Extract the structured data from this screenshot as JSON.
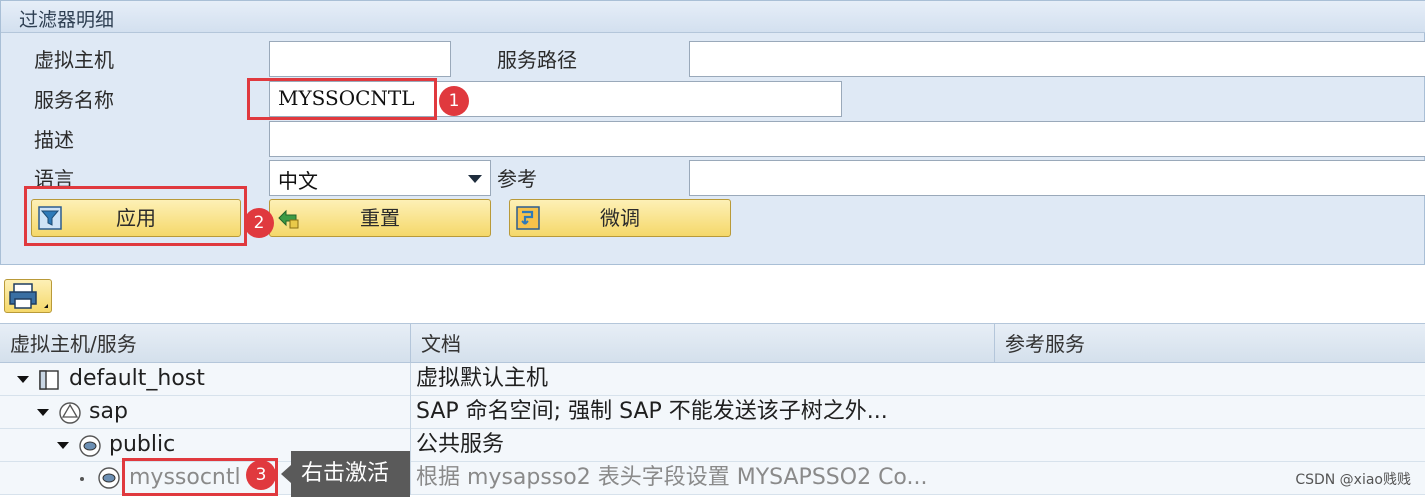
{
  "panel": {
    "title": "过滤器明细"
  },
  "form": {
    "virtual_host_label": "虚拟主机",
    "virtual_host_value": "",
    "service_path_label": "服务路径",
    "service_path_value": "",
    "service_name_label": "服务名称",
    "service_name_value": "MYSSOCNTL",
    "description_label": "描述",
    "description_value": "",
    "language_label": "语言",
    "language_value": "中文",
    "reference_label": "参考",
    "reference_value": ""
  },
  "buttons": {
    "apply": "应用",
    "reset": "重置",
    "finetune": "微调"
  },
  "badges": [
    "1",
    "2",
    "3"
  ],
  "table": {
    "headers": [
      "虚拟主机/服务",
      "文档",
      "参考服务"
    ],
    "rows": [
      {
        "name": "default_host",
        "doc": "虚拟默认主机"
      },
      {
        "name": "sap",
        "doc": "SAP 命名空间; 强制 SAP 不能发送该子树之外..."
      },
      {
        "name": "public",
        "doc": "公共服务"
      },
      {
        "name": "myssocntl",
        "doc": "根据 mysapsso2 表头字段设置 MYSAPSSO2 Co..."
      }
    ]
  },
  "tooltip": "右击激活",
  "watermark": "CSDN @xiao贱贱",
  "colors": {
    "highlight": "#e0393e",
    "button": "#f5d86a",
    "panel": "#dfe9f5"
  }
}
